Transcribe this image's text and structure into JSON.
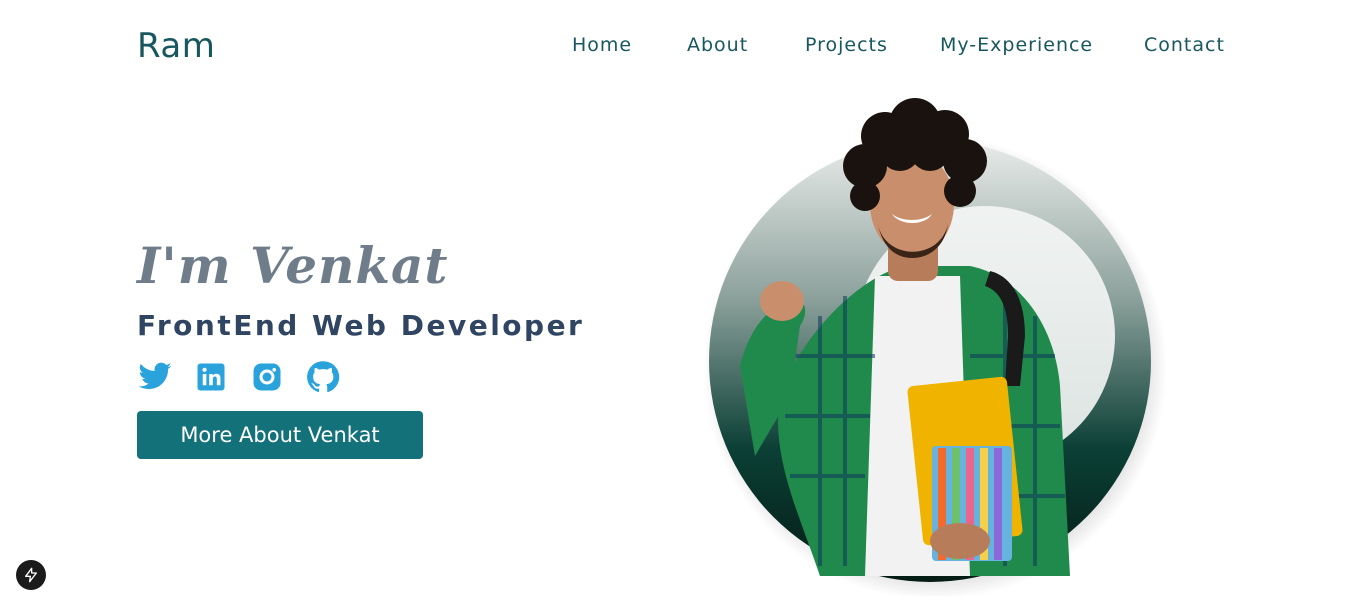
{
  "brand": {
    "logo": "Ram"
  },
  "nav": {
    "items": [
      "Home",
      "About",
      "Projects",
      "My-Experience",
      "Contact"
    ]
  },
  "hero": {
    "greeting": "I'm Venkat",
    "role": "FrontEnd Web Developer",
    "cta_label": "More About Venkat"
  },
  "socials": [
    {
      "icon": "twitter-icon"
    },
    {
      "icon": "linkedin-icon"
    },
    {
      "icon": "instagram-icon"
    },
    {
      "icon": "github-icon"
    }
  ],
  "colors": {
    "brand_teal": "#17575e",
    "button": "#13717a",
    "icon_blue": "#2aa3dd",
    "heading_dark": "#2f4561",
    "name_gray": "#6f7d8a"
  },
  "portrait": {
    "description_icon": "profile-photo"
  },
  "badge": {
    "icon": "lightning-icon"
  }
}
